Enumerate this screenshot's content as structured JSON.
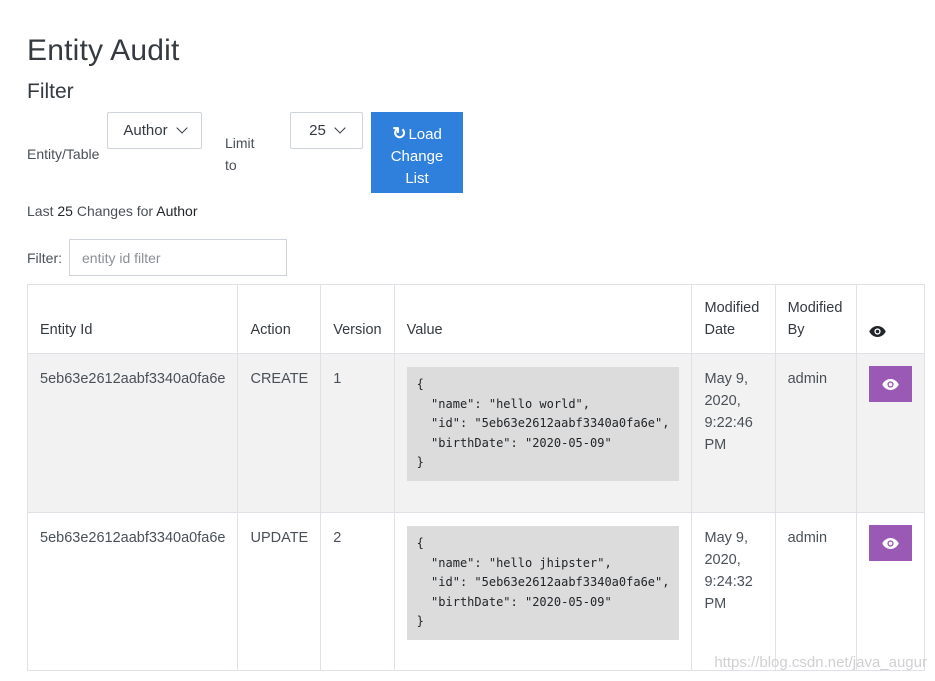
{
  "page": {
    "title": "Entity Audit",
    "subtitle": "Filter"
  },
  "controls": {
    "entity_label": "Entity/Table",
    "entity_value": "Author",
    "limit_label_1": "Limit",
    "limit_label_2": "to",
    "limit_value": "25",
    "load_label_1": "Load",
    "load_label_2": "Change",
    "load_label_3": "List"
  },
  "summary": {
    "prefix": "Last",
    "count": "25",
    "middle": "Changes for",
    "entity": "Author"
  },
  "filter": {
    "label": "Filter:",
    "placeholder": "entity id filter",
    "value": ""
  },
  "table": {
    "headers": {
      "entity_id": "Entity Id",
      "action": "Action",
      "version": "Version",
      "value": "Value",
      "modified_date_1": "Modified",
      "modified_date_2": "Date",
      "modified_by_1": "Modified",
      "modified_by_2": "By"
    },
    "rows": [
      {
        "entity_id": "5eb63e2612aabf3340a0fa6e",
        "action": "CREATE",
        "version": "1",
        "value": "{\n  \"name\": \"hello world\",\n  \"id\": \"5eb63e2612aabf3340a0fa6e\",\n  \"birthDate\": \"2020-05-09\"\n}",
        "date_1": "May 9,",
        "date_2": "2020,",
        "date_3": "9:22:46 PM",
        "by": "admin"
      },
      {
        "entity_id": "5eb63e2612aabf3340a0fa6e",
        "action": "UPDATE",
        "version": "2",
        "value": "{\n  \"name\": \"hello jhipster\",\n  \"id\": \"5eb63e2612aabf3340a0fa6e\",\n  \"birthDate\": \"2020-05-09\"\n}",
        "date_1": "May 9,",
        "date_2": "2020,",
        "date_3": "9:24:32 PM",
        "by": "admin"
      }
    ]
  },
  "watermark": "https://blog.csdn.net/java_augur",
  "icons": {
    "header_eye": "eye-icon",
    "row_eye": "eye-icon",
    "refresh": "refresh-icon",
    "dropdown": "chevron-down-icon"
  },
  "colors": {
    "primary": "#2f80dd",
    "view_button": "#9b59b6",
    "row_alt": "#f2f2f2",
    "code_bg": "#dcdcdc"
  }
}
